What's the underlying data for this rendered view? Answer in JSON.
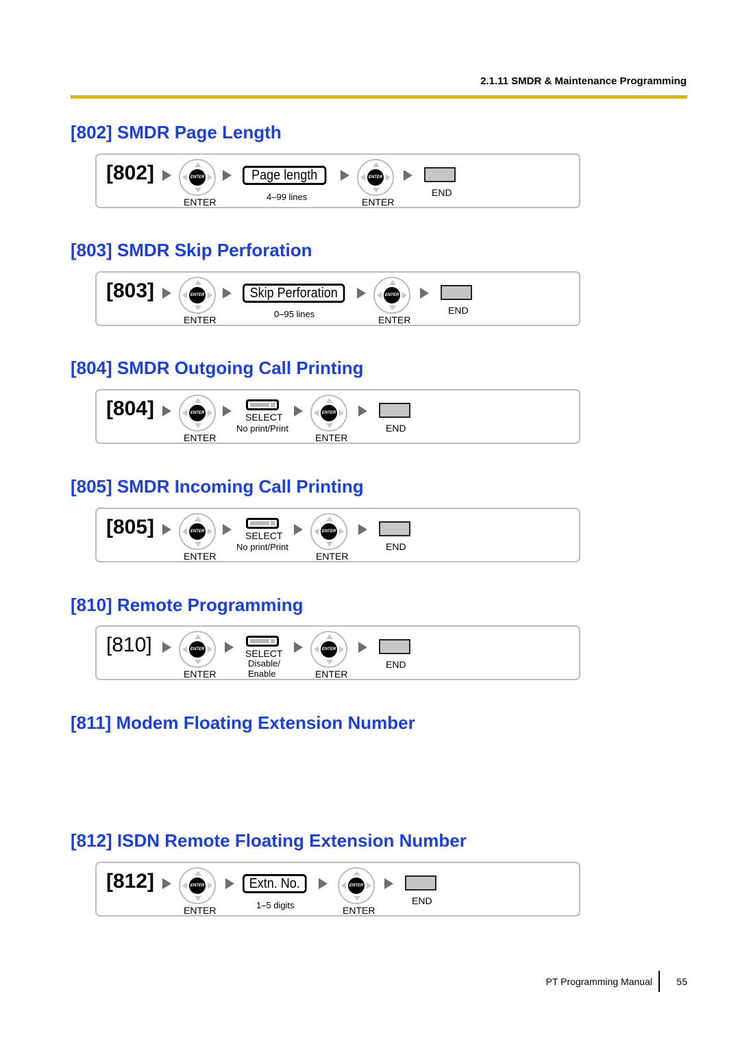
{
  "header": {
    "running_head": "2.1.11 SMDR & Maintenance Programming",
    "rule_color": "#e0b800"
  },
  "title_color": "#1a3fe0",
  "sections": [
    {
      "title": "[802] SMDR Page Length",
      "code": "[802]",
      "enter1": "ENTER",
      "key": "Page length",
      "key_note": "4–99 lines",
      "enter2": "ENTER",
      "end": "END"
    },
    {
      "title": "[803] SMDR Skip Perforation",
      "code": "[803]",
      "enter1": "ENTER",
      "key": "Skip Perforation",
      "key_note": "0–95 lines",
      "enter2": "ENTER",
      "end": "END"
    },
    {
      "title": "[804] SMDR Outgoing Call Printing",
      "code": "[804]",
      "enter1": "ENTER",
      "select": "SELECT",
      "select_note": "No print/Print",
      "enter2": "ENTER",
      "end": "END"
    },
    {
      "title": "[805] SMDR Incoming Call Printing",
      "code": "[805]",
      "enter1": "ENTER",
      "select": "SELECT",
      "select_note": "No print/Print",
      "enter2": "ENTER",
      "end": "END"
    },
    {
      "title": "[810] Remote Programming",
      "code": "[810]",
      "enter1": "ENTER",
      "select": "SELECT",
      "select_note_1": "Disable/",
      "select_note_2": "Enable",
      "enter2": "ENTER",
      "end": "END"
    },
    {
      "title": "[811] Modem Floating Extension Number"
    },
    {
      "title": "[812] ISDN Remote Floating Extension Number",
      "code": "[812]",
      "enter1": "ENTER",
      "key": "Extn. No.",
      "key_note": "1–5 digits",
      "enter2": "ENTER",
      "end": "END"
    }
  ],
  "enter_key_text": "ENTER",
  "footer": {
    "manual": "PT Programming Manual",
    "page": "55"
  }
}
